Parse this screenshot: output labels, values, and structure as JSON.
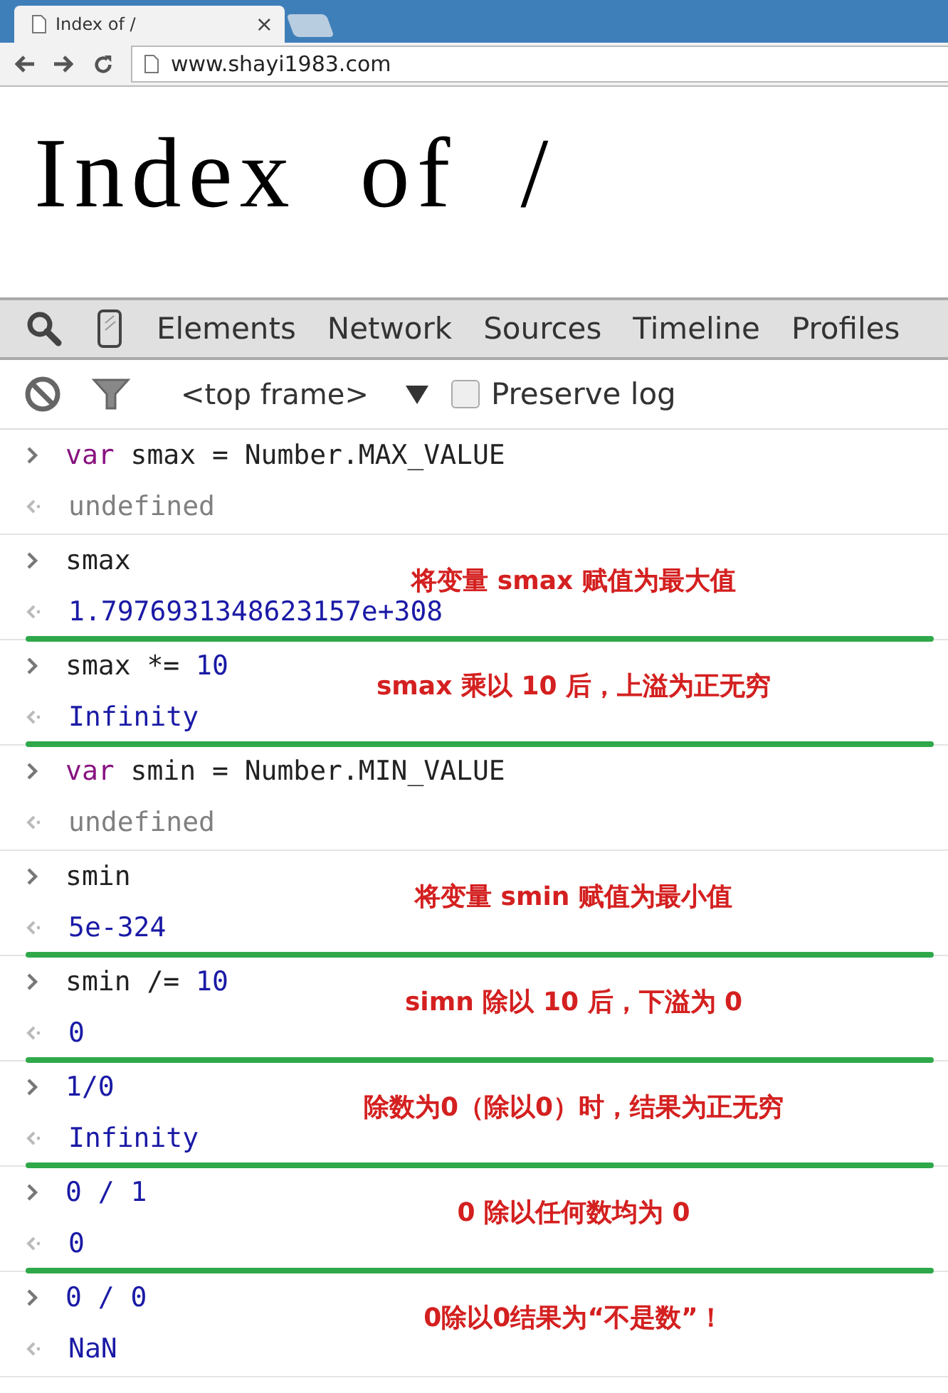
{
  "browser": {
    "tab": {
      "title": "Index of /",
      "close": "×"
    },
    "address": "www.shayi1983.com"
  },
  "page": {
    "heading": "Index of /"
  },
  "devtools": {
    "tabs": [
      {
        "label": "Elements",
        "selected": false
      },
      {
        "label": "Network",
        "selected": false
      },
      {
        "label": "Sources",
        "selected": false
      },
      {
        "label": "Timeline",
        "selected": false
      },
      {
        "label": "Profiles",
        "selected": false
      }
    ],
    "frame_select": "<top frame>",
    "preserve_log": {
      "label": "Preserve log",
      "checked": false
    }
  },
  "console": [
    {
      "input": [
        {
          "kind": "keyword",
          "text": "var"
        },
        {
          "kind": "plain",
          "text": " smax = Number.MAX_VALUE"
        }
      ],
      "output": {
        "kind": "undefined",
        "text": "undefined"
      },
      "underlined": false
    },
    {
      "input": [
        {
          "kind": "plain",
          "text": "smax"
        }
      ],
      "output": {
        "kind": "value",
        "text": "1.7976931348623157e+308"
      },
      "note": "将变量 smax 赋值为最大值",
      "underlined": true
    },
    {
      "input": [
        {
          "kind": "plain",
          "text": "smax *= "
        },
        {
          "kind": "number",
          "text": "10"
        }
      ],
      "output": {
        "kind": "value",
        "text": "Infinity"
      },
      "note": "smax 乘以 10 后，上溢为正无穷",
      "underlined": true
    },
    {
      "input": [
        {
          "kind": "keyword",
          "text": "var"
        },
        {
          "kind": "plain",
          "text": " smin = Number.MIN_VALUE"
        }
      ],
      "output": {
        "kind": "undefined",
        "text": "undefined"
      },
      "underlined": false
    },
    {
      "input": [
        {
          "kind": "plain",
          "text": "smin"
        }
      ],
      "output": {
        "kind": "value",
        "text": "5e-324"
      },
      "note": "将变量 smin 赋值为最小值",
      "underlined": true
    },
    {
      "input": [
        {
          "kind": "plain",
          "text": "smin /= "
        },
        {
          "kind": "number",
          "text": "10"
        }
      ],
      "output": {
        "kind": "value",
        "text": "0"
      },
      "note": "simn 除以 10 后，下溢为 0",
      "underlined": true
    },
    {
      "input": [
        {
          "kind": "number",
          "text": "1/0"
        }
      ],
      "output": {
        "kind": "value",
        "text": "Infinity"
      },
      "note": "除数为0（除以0）时，结果为正无穷",
      "underlined": true
    },
    {
      "input": [
        {
          "kind": "number",
          "text": "0 / 1"
        }
      ],
      "output": {
        "kind": "value",
        "text": "0"
      },
      "note": "0 除以任何数均为 0",
      "underlined": true
    },
    {
      "input": [
        {
          "kind": "number",
          "text": "0 / 0"
        }
      ],
      "output": {
        "kind": "value",
        "text": "NaN"
      },
      "note": "0除以0结果为“不是数”！",
      "underlined": false
    }
  ]
}
